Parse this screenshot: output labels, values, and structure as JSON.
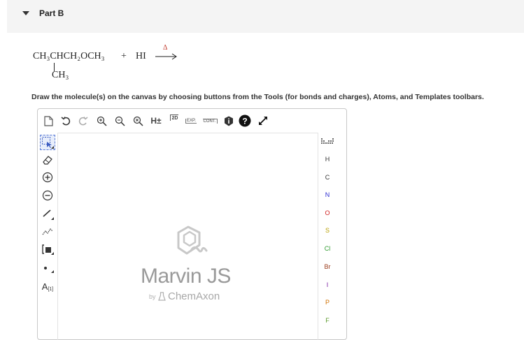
{
  "part": {
    "title": "Part B"
  },
  "reaction": {
    "reactant_main": "CH₃CHCH₂OCH₃",
    "plus": "+",
    "reagent": "HI",
    "condition": "Δ",
    "branch": "CH₃"
  },
  "instructions": "Draw the molecule(s) on the canvas by choosing buttons from the Tools (for bonds and charges), Atoms, and Templates toolbars.",
  "toolbar": {
    "h_label": "H±",
    "clean2d_label": "2D",
    "expand_label": "EXP.",
    "contract_label": "CONT."
  },
  "left_tools": {
    "atom_map_label": "A",
    "atom_map_index": "[1]"
  },
  "atoms": [
    "H",
    "C",
    "N",
    "O",
    "S",
    "Cl",
    "Br",
    "I",
    "P",
    "F"
  ],
  "atom_colors": [
    "#333333",
    "#333333",
    "#2b2bd0",
    "#d02020",
    "#b8a000",
    "#2f9a2f",
    "#9a3a1a",
    "#7b1fa2",
    "#d07000",
    "#5a9a2a"
  ],
  "logo": {
    "name": "Marvin JS",
    "by": "by",
    "company": "ChemAxon"
  }
}
